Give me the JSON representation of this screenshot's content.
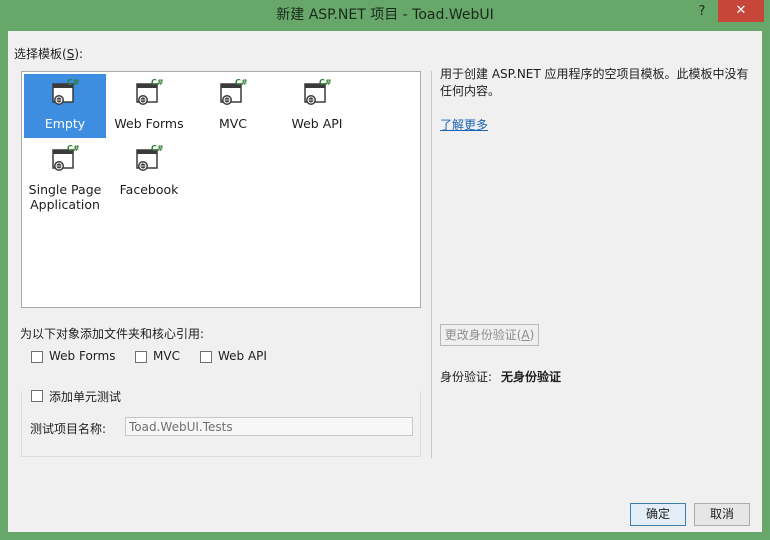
{
  "window": {
    "title": "新建 ASP.NET 项目 - Toad.WebUI",
    "help_glyph": "?",
    "close_glyph": "✕"
  },
  "templates_label": "选择模板(S):",
  "templates_label_parts": {
    "pre": "选择模板(",
    "key": "S",
    "post": "):"
  },
  "templates": [
    {
      "name": "Empty",
      "icon": "csharp-project-icon",
      "selected": true
    },
    {
      "name": "Web Forms",
      "icon": "csharp-project-icon",
      "selected": false
    },
    {
      "name": "MVC",
      "icon": "csharp-project-icon",
      "selected": false
    },
    {
      "name": "Web API",
      "icon": "csharp-project-icon",
      "selected": false
    },
    {
      "name_line1": "Single Page",
      "name_line2": "Application",
      "icon": "csharp-project-icon",
      "selected": false
    },
    {
      "name": "Facebook",
      "icon": "csharp-project-icon",
      "selected": false
    }
  ],
  "description": "用于创建 ASP.NET 应用程序的空项目模板。此模板中没有任何内容。",
  "learn_more": "了解更多",
  "core_refs": {
    "label": "为以下对象添加文件夹和核心引用:",
    "options": [
      {
        "label": "Web Forms",
        "checked": false
      },
      {
        "label": "MVC",
        "checked": false
      },
      {
        "label": "Web API",
        "checked": false
      }
    ]
  },
  "unit_test": {
    "label": "添加单元测试",
    "checked": false,
    "name_label": "测试项目名称:",
    "name_value": "Toad.WebUI.Tests"
  },
  "auth": {
    "change_button": "更改身份验证(A)",
    "change_parts": {
      "pre": "更改身份验证(",
      "key": "A",
      "post": ")"
    },
    "label": "身份验证:",
    "value": "无身份验证"
  },
  "buttons": {
    "ok": "确定",
    "cancel": "取消"
  },
  "colors": {
    "frame": "#67a76a",
    "selection": "#3d8ee0",
    "close": "#c7463a",
    "link": "#1964b4"
  }
}
